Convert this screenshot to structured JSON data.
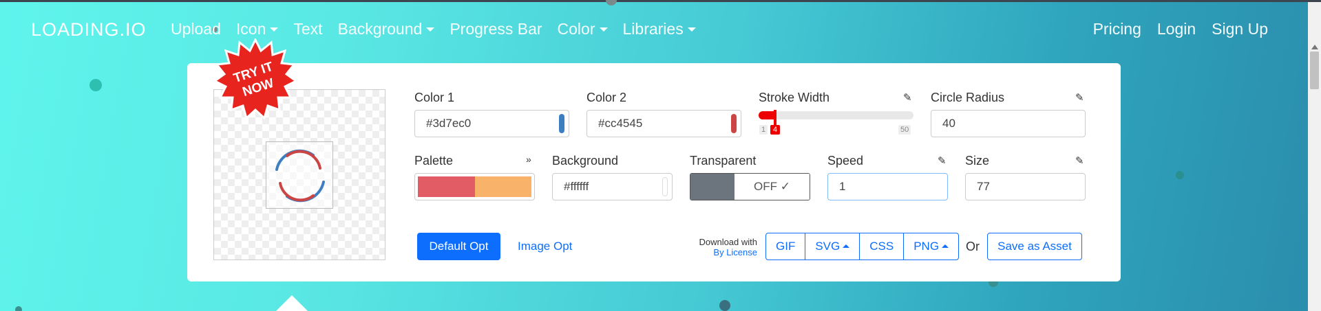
{
  "nav": {
    "brand": "LOADING.IO",
    "items": [
      {
        "label": "Upload",
        "dropdown": false
      },
      {
        "label": "Icon",
        "dropdown": true
      },
      {
        "label": "Text",
        "dropdown": false
      },
      {
        "label": "Background",
        "dropdown": true
      },
      {
        "label": "Progress Bar",
        "dropdown": false
      },
      {
        "label": "Color",
        "dropdown": true
      },
      {
        "label": "Libraries",
        "dropdown": true
      }
    ],
    "right": [
      "Pricing",
      "Login",
      "Sign Up"
    ]
  },
  "badge": {
    "line1": "TRY IT",
    "line2": "NOW"
  },
  "fields": {
    "color1": {
      "label": "Color 1",
      "value": "#3d7ec0",
      "swatch": "#3d7ec0"
    },
    "color2": {
      "label": "Color 2",
      "value": "#cc4545",
      "swatch": "#cc4545"
    },
    "stroke_width": {
      "label": "Stroke Width",
      "value": 4,
      "min": "1",
      "max": "50",
      "value_label": "4"
    },
    "circle_radius": {
      "label": "Circle Radius",
      "value": "40"
    },
    "palette": {
      "label": "Palette",
      "colors": [
        "#e15c64",
        "#f8b26a"
      ]
    },
    "background": {
      "label": "Background",
      "value": "#ffffff"
    },
    "transparent": {
      "label": "Transparent",
      "state": "OFF ✓"
    },
    "speed": {
      "label": "Speed",
      "value": "1"
    },
    "size": {
      "label": "Size",
      "value": "77"
    }
  },
  "actions": {
    "default_opt": "Default Opt",
    "image_opt": "Image Opt",
    "download_with": "Download with",
    "by_license": "By License",
    "formats": [
      "GIF",
      "SVG",
      "CSS",
      "PNG"
    ],
    "or": "Or",
    "save_asset": "Save as Asset"
  },
  "colors": {
    "primary": "#0d6efd",
    "accent_red": "#e00000",
    "background_from": "#5ef4ec",
    "background_to": "#2a8cac"
  }
}
